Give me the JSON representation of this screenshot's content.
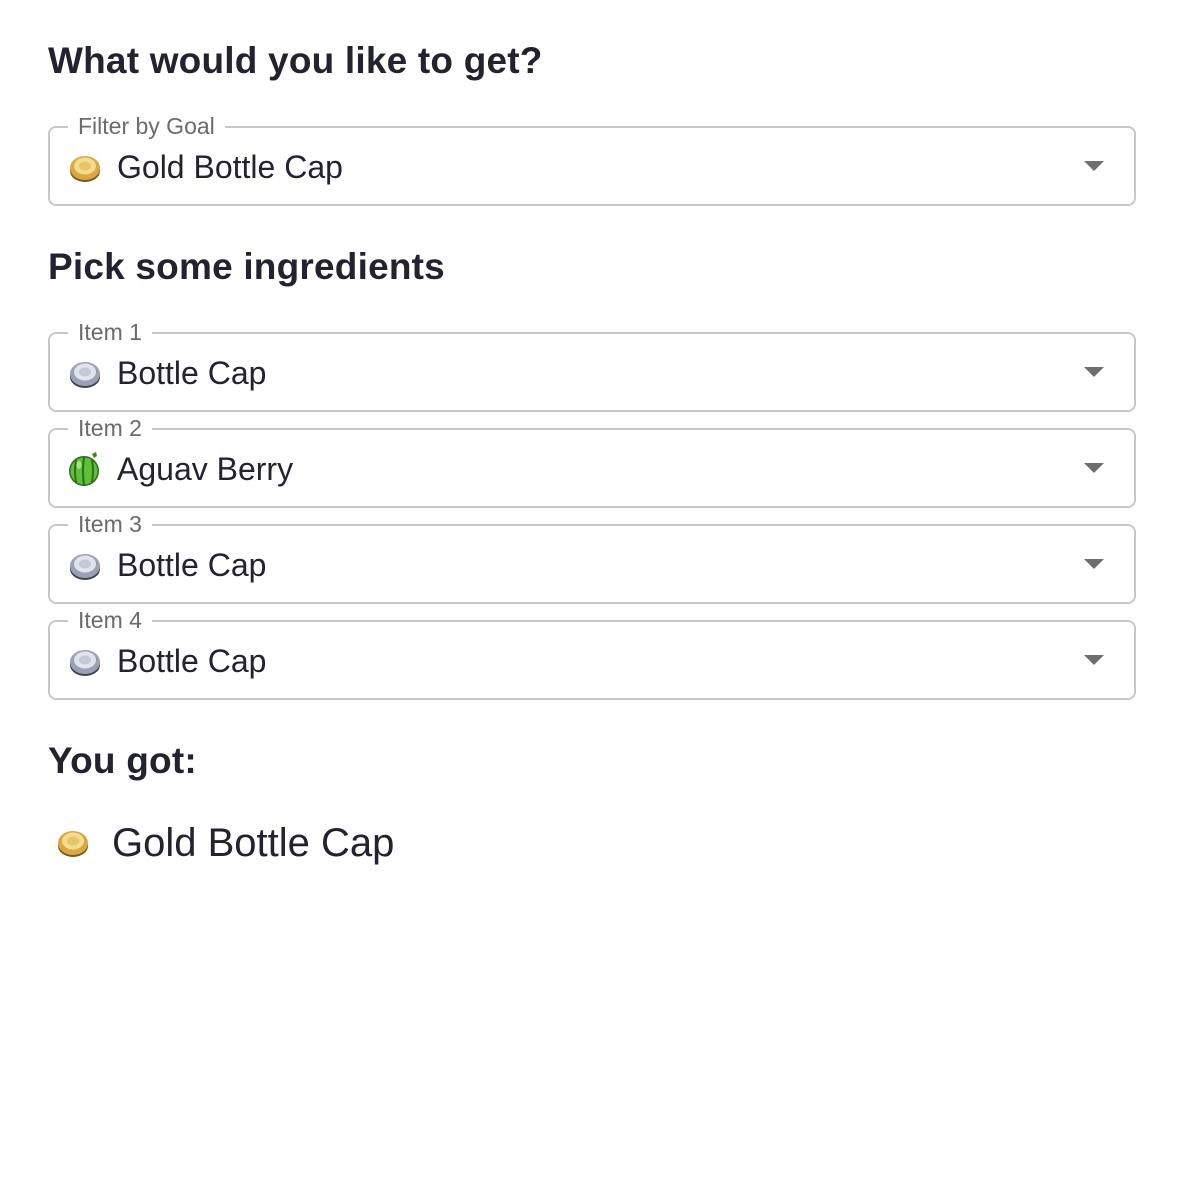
{
  "goal_section": {
    "heading": "What would you like to get?",
    "filter": {
      "label": "Filter by Goal",
      "value": "Gold Bottle Cap",
      "icon": "gold-bottle-cap-icon"
    }
  },
  "ingredients_section": {
    "heading": "Pick some ingredients",
    "items": [
      {
        "label": "Item 1",
        "value": "Bottle Cap",
        "icon": "bottle-cap-icon"
      },
      {
        "label": "Item 2",
        "value": "Aguav Berry",
        "icon": "aguav-berry-icon"
      },
      {
        "label": "Item 3",
        "value": "Bottle Cap",
        "icon": "bottle-cap-icon"
      },
      {
        "label": "Item 4",
        "value": "Bottle Cap",
        "icon": "bottle-cap-icon"
      }
    ]
  },
  "result_section": {
    "heading": "You got:",
    "result": {
      "value": "Gold Bottle Cap",
      "icon": "gold-bottle-cap-icon"
    }
  },
  "colors": {
    "text": "#23232f",
    "label": "#6b6b6b",
    "border": "#c8c8c8",
    "arrow": "#6f6f6f",
    "gold_cap": "#e6c472",
    "silver_cap": "#c3c9d6",
    "berry": "#5fbf3a"
  }
}
